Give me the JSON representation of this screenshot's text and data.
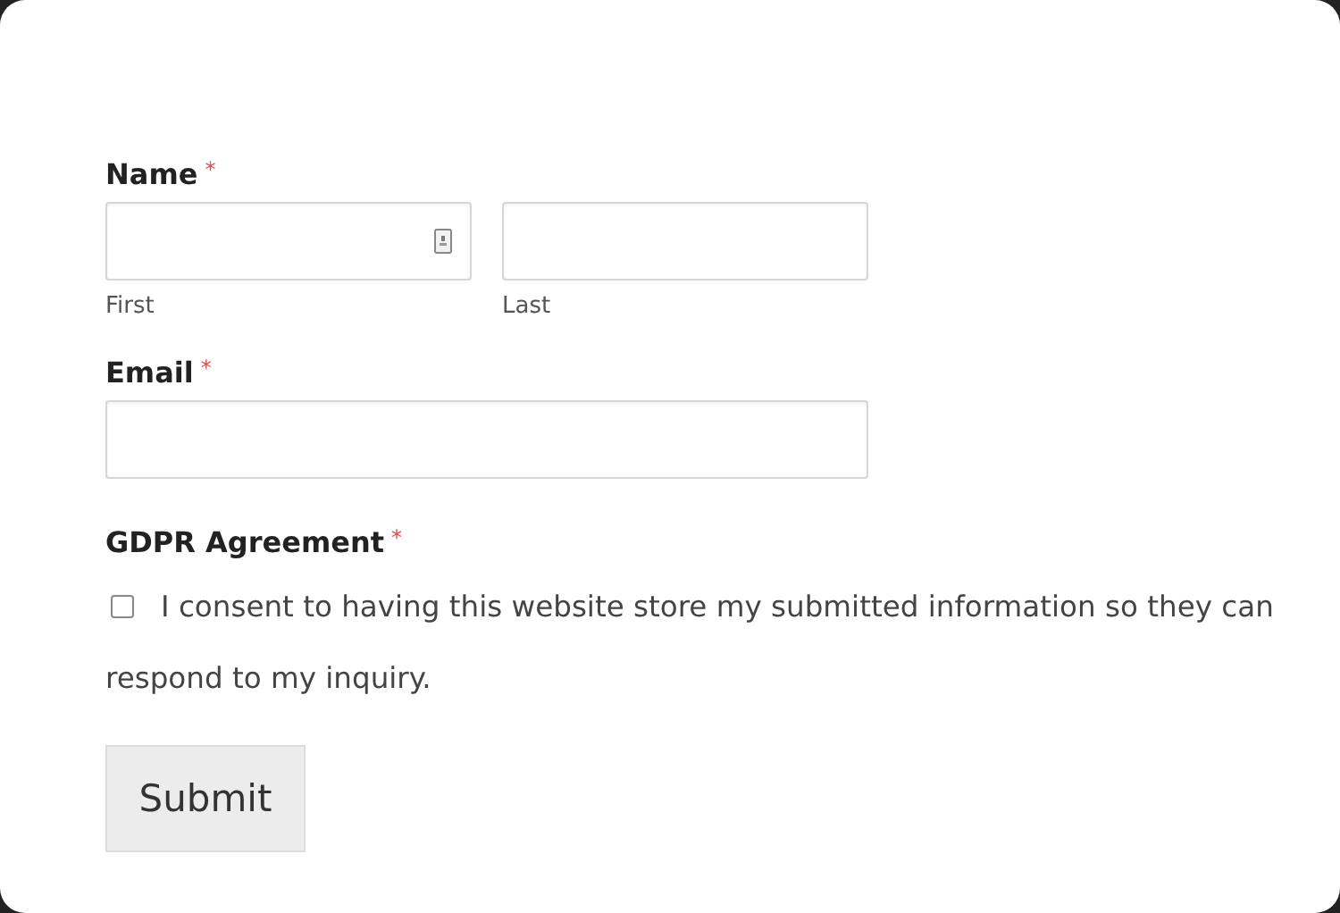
{
  "required_marker": "*",
  "name_field": {
    "label": "Name",
    "required": true,
    "autofill_icon": true,
    "parts": [
      {
        "sublabel": "First"
      },
      {
        "sublabel": "Last"
      }
    ]
  },
  "email_field": {
    "label": "Email",
    "required": true
  },
  "gdpr": {
    "label": "GDPR Agreement",
    "required": true,
    "checked": false,
    "text_lines": [
      "I consent to having this website store my submitted information so they can",
      "respond to my inquiry."
    ]
  },
  "submit": {
    "label": "Submit"
  }
}
